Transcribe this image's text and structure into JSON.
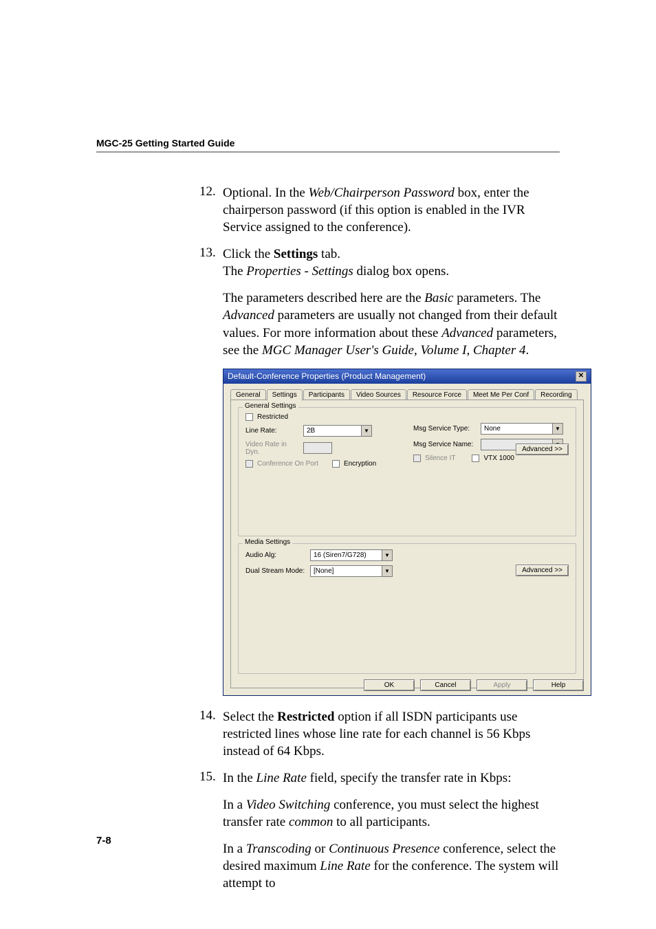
{
  "running_head": "MGC-25 Getting Started Guide",
  "page_number": "7-8",
  "steps": {
    "s12": {
      "num": "12.",
      "text_before": "Optional. In the ",
      "text_i1": "Web/Chairperson Password",
      "text_mid1": " box, enter the chairperson password (if this option is enabled in the IVR Service assigned to the conference)."
    },
    "s13": {
      "num": "13.",
      "text_before": "Click the ",
      "text_b1": "Settings",
      "text_after": " tab.",
      "line2_a": "The ",
      "line2_i": "Properties - Settings",
      "line2_b": " dialog box opens.",
      "para2_a": "The parameters described here are the ",
      "para2_i1": "Basic",
      "para2_b": " parameters. The ",
      "para2_i2": "Advanced",
      "para2_c": " parameters are usually not changed from their default values. For more information about these ",
      "para2_i3": "Advanced",
      "para2_d": " parameters, see the ",
      "para2_i4": "MGC Manager User's Guide, Volume I, Chapter 4",
      "para2_e": "."
    },
    "s14": {
      "num": "14.",
      "a": "Select the ",
      "b": "Restricted",
      "c": " option if all ISDN participants use restricted lines whose line rate for each channel is 56 Kbps instead of 64 Kbps."
    },
    "s15": {
      "num": "15.",
      "a": "In the ",
      "i": "Line Rate",
      "b": " field, specify the transfer rate in Kbps:",
      "p1a": "In a ",
      "p1i": "Video Switching",
      "p1b": " conference, you must select the highest transfer rate ",
      "p1i2": "common",
      "p1c": " to all participants.",
      "p2a": "In a ",
      "p2i1": "Transcoding",
      "p2b": " or ",
      "p2i2": "Continuous Presence",
      "p2c": " conference, select the desired maximum ",
      "p2i3": "Line Rate",
      "p2d": " for the conference. The system will attempt to"
    }
  },
  "dialog": {
    "title": "Default-Conference Properties  (Product Management)",
    "close_x": "✕",
    "tabs": {
      "general": "General",
      "settings": "Settings",
      "participants": "Participants",
      "video_sources": "Video Sources",
      "resource_force": "Resource Force",
      "meet_me": "Meet Me Per Conf",
      "recording": "Recording"
    },
    "general_settings": {
      "legend": "General Settings",
      "restricted": "Restricted",
      "line_rate": "Line Rate:",
      "line_rate_val": "2B",
      "video_rate": "Video Rate in Dyn.",
      "conf_on_port": "Conference On Port",
      "encryption": "Encryption",
      "msg_type": "Msg Service Type:",
      "msg_type_val": "None",
      "msg_name": "Msg Service Name:",
      "silence_it": "Silence IT",
      "vtx1000": "VTX 1000",
      "advanced": "Advanced >>"
    },
    "media_settings": {
      "legend": "Media Settings",
      "audio_alg": "Audio Alg:",
      "audio_alg_val": "16 (Siren7/G728)",
      "dual_stream": "Dual Stream Mode:",
      "dual_stream_val": "[None]",
      "advanced": "Advanced >>"
    },
    "buttons": {
      "ok": "OK",
      "cancel": "Cancel",
      "apply": "Apply",
      "help": "Help"
    }
  }
}
